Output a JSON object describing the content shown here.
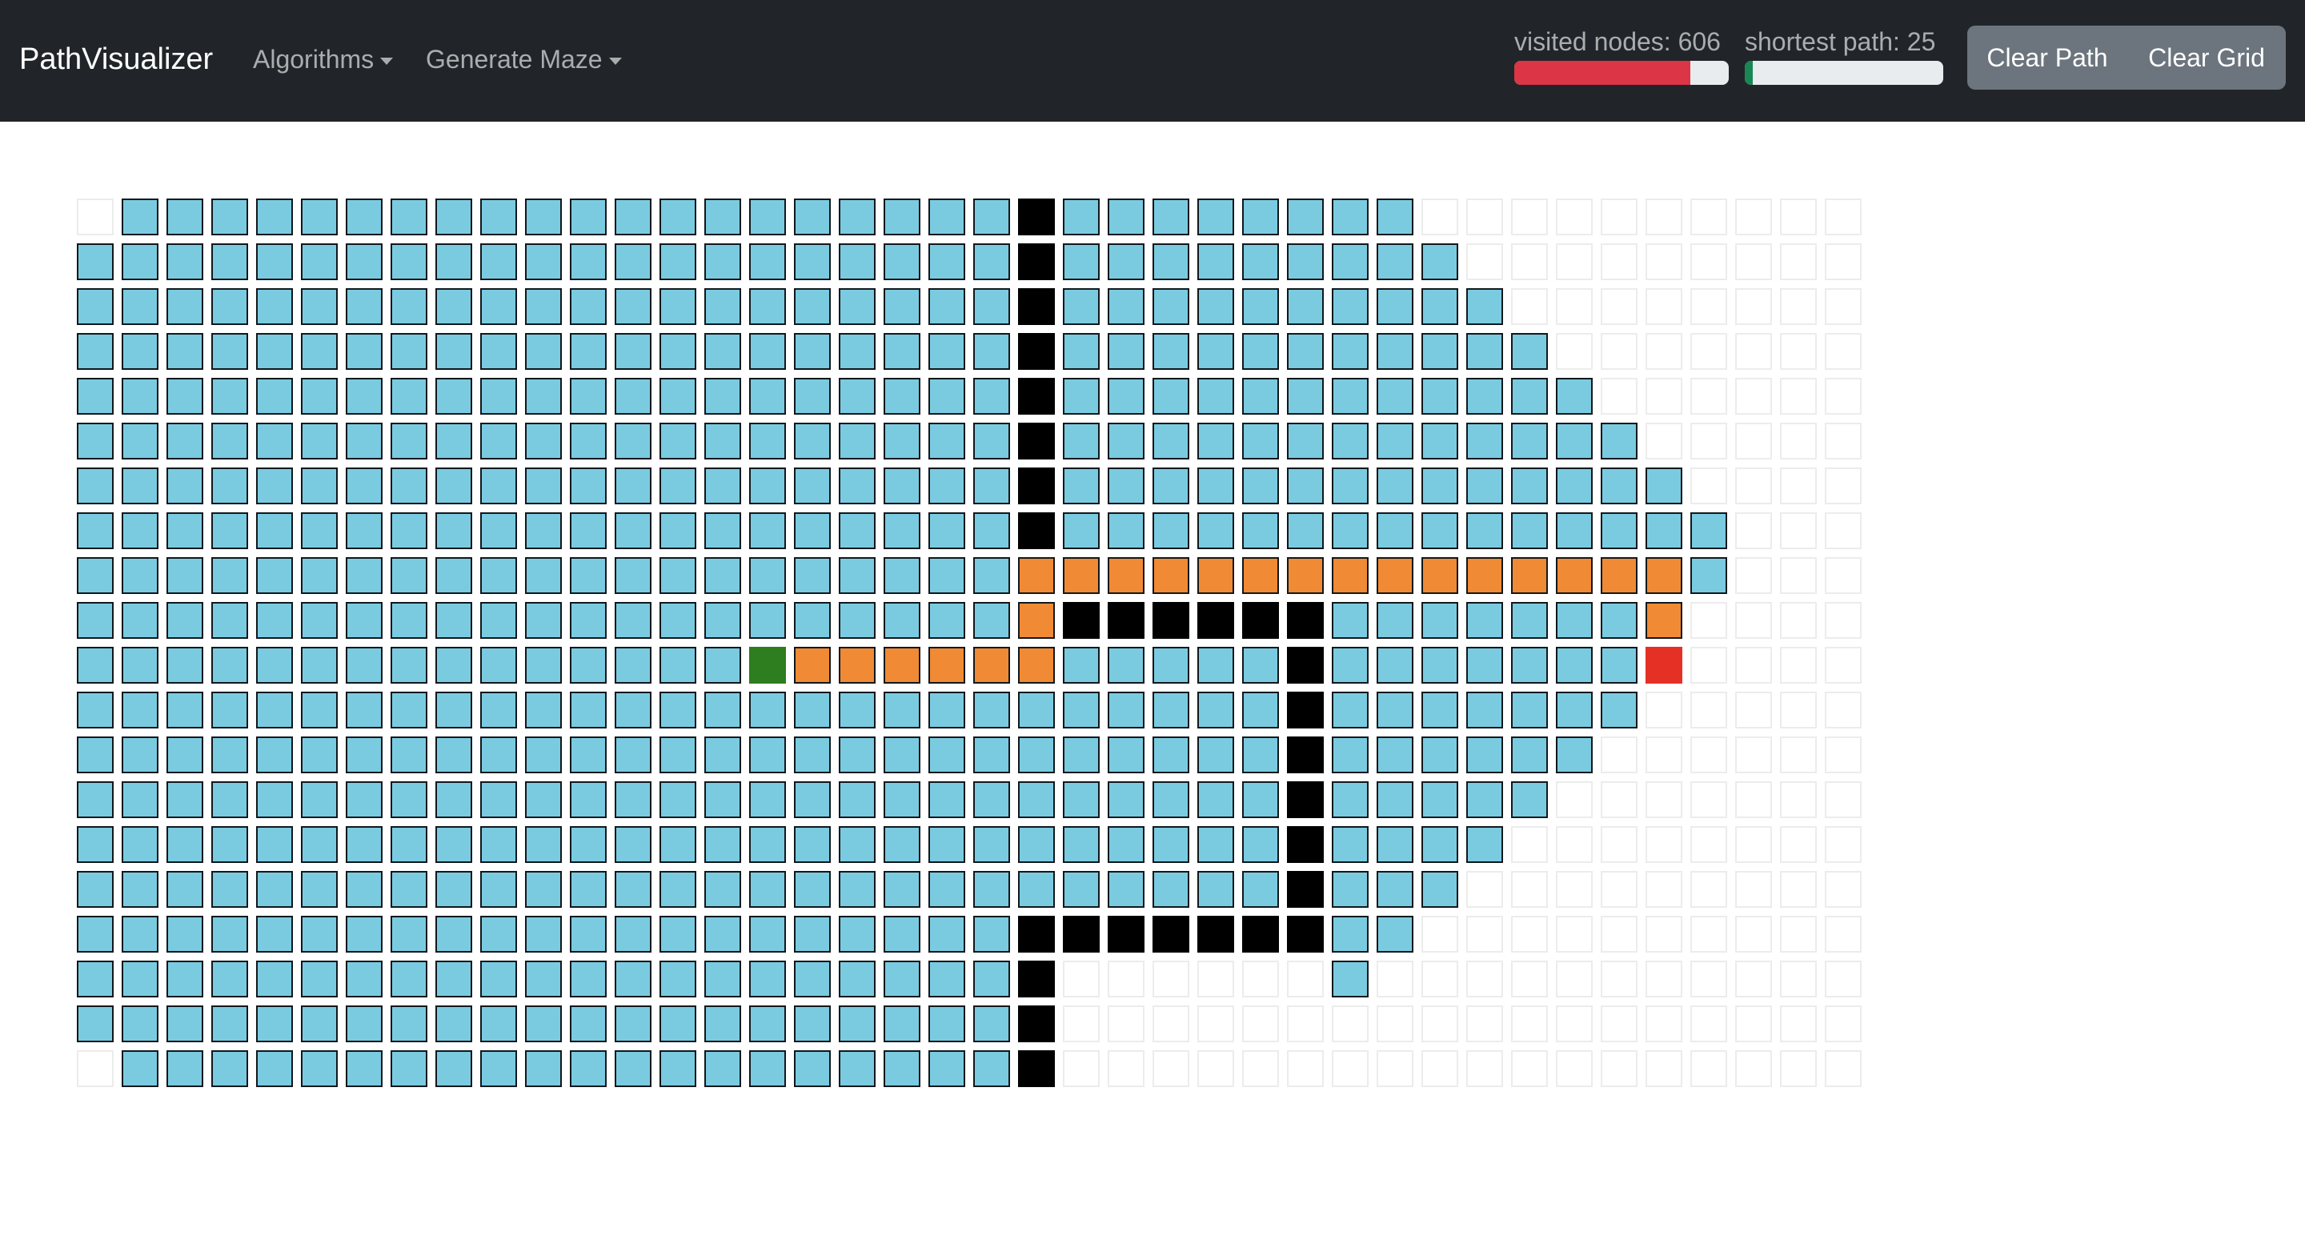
{
  "navbar": {
    "brand": "PathVisualizer",
    "menus": [
      {
        "label": "Algorithms"
      },
      {
        "label": "Generate Maze"
      }
    ],
    "stats": {
      "visited_label": "visited nodes: 606",
      "visited_fraction": 0.82,
      "shortest_label": "shortest path: 25",
      "shortest_fraction": 0.04
    },
    "buttons": {
      "clear_path": "Clear Path",
      "clear_grid": "Clear Grid"
    }
  },
  "colors": {
    "navbar_bg": "#212529",
    "visited": "#7bcbe0",
    "wall": "#000000",
    "path": "#f08a34",
    "start": "#2e7d1e",
    "finish": "#e53125",
    "visited_progress": "#dc3545",
    "shortest_progress": "#198754",
    "button": "#6c757d"
  },
  "grid": {
    "rows": 20,
    "cols": 40,
    "legend": {
      ".": "empty",
      "V": "visited",
      "W": "wall",
      "P": "shortest-path",
      "S": "start",
      "F": "finish"
    },
    "cells": [
      ".VVVVVVVVVVVVVVVVVVVVWVVVVVVVV..........",
      "VVVVVVVVVVVVVVVVVVVVVWVVVVVVVVV.........",
      "VVVVVVVVVVVVVVVVVVVVVWVVVVVVVVVV........",
      "VVVVVVVVVVVVVVVVVVVVVWVVVVVVVVVVV.......",
      "VVVVVVVVVVVVVVVVVVVVVWVVVVVVVVVVVV......",
      "VVVVVVVVVVVVVVVVVVVVVWVVVVVVVVVVVVV.....",
      "VVVVVVVVVVVVVVVVVVVVVWVVVVVVVVVVVVVV....",
      "VVVVVVVVVVVVVVVVVVVVVWVVVVVVVVVVVVVVV...",
      "VVVVVVVVVVVVVVVVVVVVVPPPPPPPPPPPPPPPV...",
      "VVVVVVVVVVVVVVVVVVVVVPWWWWWWVVVVVVVP....",
      "VVVVVVVVVVVVVVVSPPPPPPVVVVVWVVVVVVVF....",
      "VVVVVVVVVVVVVVVVVVVVVVVVVVVWVVVVVVV.....",
      "VVVVVVVVVVVVVVVVVVVVVVVVVVVWVVVVVV......",
      "VVVVVVVVVVVVVVVVVVVVVVVVVVVWVVVVV.......",
      "VVVVVVVVVVVVVVVVVVVVVVVVVVVWVVVV........",
      "VVVVVVVVVVVVVVVVVVVVVVVVVVVWVVV.........",
      "VVVVVVVVVVVVVVVVVVVVVWWWWWWWVV..........",
      "VVVVVVVVVVVVVVVVVVVVVW......V...........",
      "VVVVVVVVVVVVVVVVVVVVVW..................",
      ".VVVVVVVVVVVVVVVVVVVVW.................."
    ]
  }
}
